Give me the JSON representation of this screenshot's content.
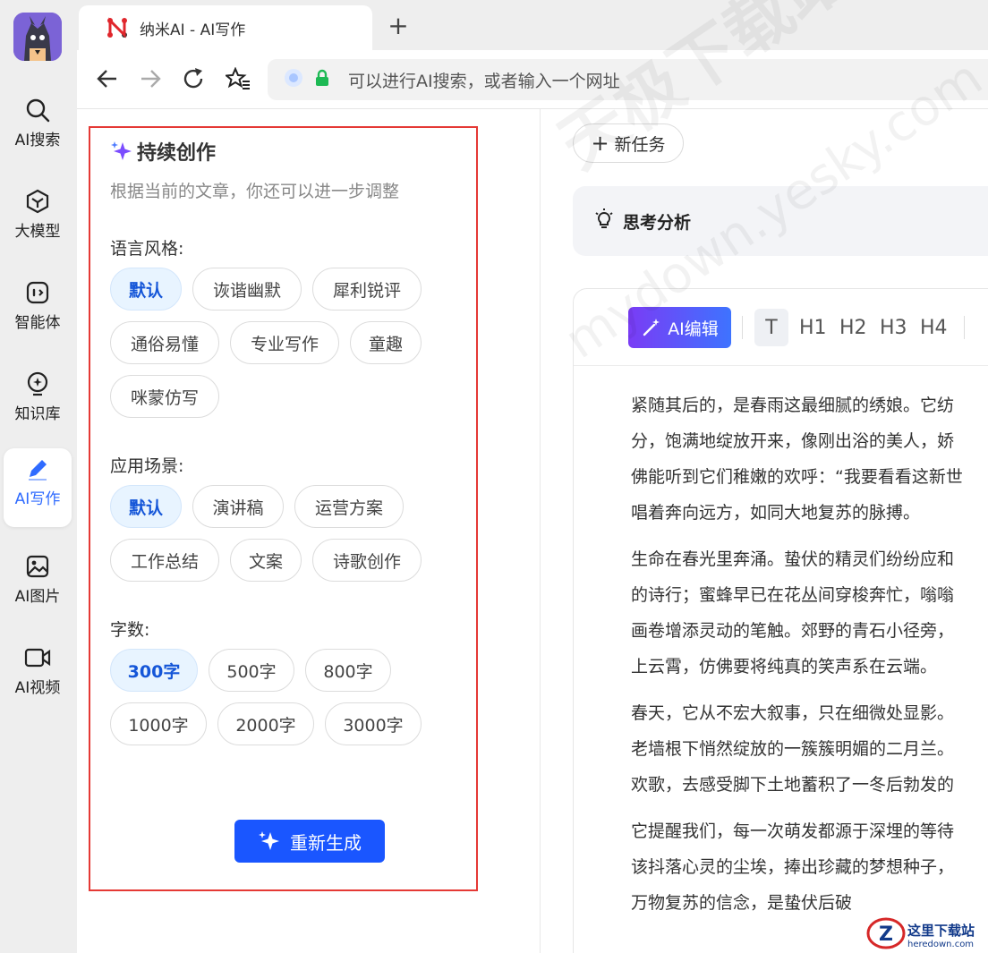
{
  "rail": {
    "items": [
      {
        "label": "AI搜索",
        "icon": "search-icon"
      },
      {
        "label": "大模型",
        "icon": "cube-icon"
      },
      {
        "label": "智能体",
        "icon": "agent-icon"
      },
      {
        "label": "知识库",
        "icon": "bulb-icon"
      },
      {
        "label": "AI写作",
        "icon": "pen-icon",
        "active": true
      },
      {
        "label": "AI图片",
        "icon": "image-icon"
      },
      {
        "label": "AI视频",
        "icon": "video-icon"
      }
    ]
  },
  "browser": {
    "tab_title": "纳米AI - AI写作",
    "omnibox_placeholder": "可以进行AI搜索，或者输入一个网址"
  },
  "panel": {
    "title": "持续创作",
    "subtitle": "根据当前的文章，你还可以进一步调整",
    "style_label": "语言风格:",
    "style_options": [
      "默认",
      "诙谐幽默",
      "犀利锐评",
      "通俗易懂",
      "专业写作",
      "童趣",
      "咪蒙仿写"
    ],
    "scene_label": "应用场景:",
    "scene_options": [
      "默认",
      "演讲稿",
      "运营方案",
      "工作总结",
      "文案",
      "诗歌创作"
    ],
    "count_label": "字数:",
    "count_options": [
      "300字",
      "500字",
      "800字",
      "1000字",
      "2000字",
      "3000字"
    ],
    "regen_label": "重新生成"
  },
  "right": {
    "new_task": "新任务",
    "think_label": "思考分析",
    "toolbar": {
      "ai_edit": "AI编辑",
      "text": "T",
      "h1": "H1",
      "h2": "H2",
      "h3": "H3",
      "h4": "H4"
    },
    "paragraphs": [
      "紧随其后的，是春雨这最细腻的绣娘。它纺",
      "分，饱满地绽放开来，像刚出浴的美人，娇",
      "佛能听到它们稚嫩的欢呼：“我要看看这新世",
      "唱着奔向远方，如同大地复苏的脉搏。",
      "生命在春光里奔涌。蛰伏的精灵们纷纷应和",
      "的诗行；蜜蜂早已在花丛间穿梭奔忙，嗡嗡",
      "画卷增添灵动的笔触。郊野的青石小径旁，",
      "上云霄，仿佛要将纯真的笑声系在云端。",
      "春天，它从不宏大叙事，只在细微处显影。",
      "老墙根下悄然绽放的一簇簇明媚的二月兰。",
      "欢歌，去感受脚下土地蓄积了一冬后勃发的",
      "它提醒我们，每一次萌发都源于深埋的等待",
      "该抖落心灵的尘埃，捧出珍藏的梦想种子，",
      "万物复苏的信念，是蛰伏后破"
    ]
  },
  "watermark": {
    "line1": "天极下载站",
    "line2": "mydown.yesky.com"
  },
  "badge": {
    "name": "这里下载站",
    "url": "heredown.com"
  }
}
